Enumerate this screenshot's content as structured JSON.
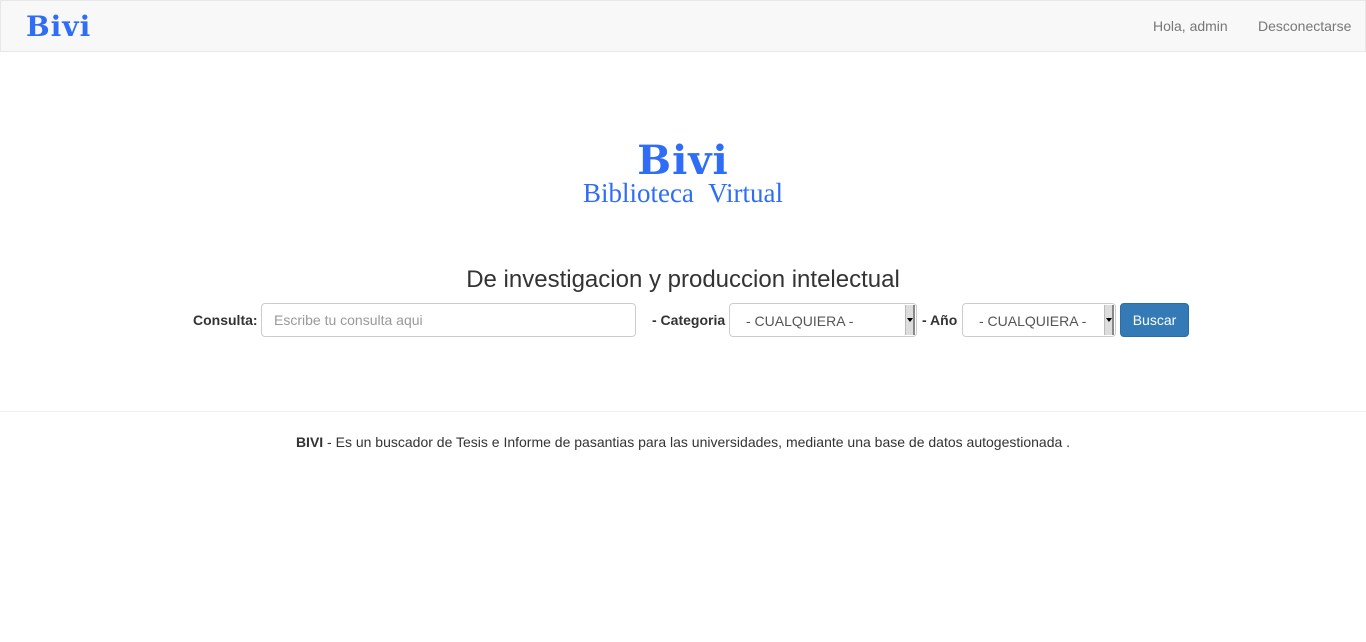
{
  "navbar": {
    "brand": "Bivi",
    "greeting": "Hola, admin",
    "logout": "Desconectarse"
  },
  "hero": {
    "title": "Bivi",
    "subtitle": "Biblioteca  Virtual"
  },
  "tagline": "De investigacion y produccion intelectual",
  "search": {
    "query_label": "Consulta:",
    "query_placeholder": "Escribe tu consulta aqui",
    "query_value": "",
    "category_label": "- Categoria",
    "category_selected": "- CUALQUIERA -",
    "year_label": "- Año",
    "year_selected": "- CUALQUIERA -",
    "submit_label": "Buscar"
  },
  "footer": {
    "brand": "BIVI",
    "description": " - Es un buscador de Tesis e Informe de pasantias para las universidades, mediante una base de datos autogestionada ."
  },
  "colors": {
    "brand": "#2f6df7",
    "button": "#337ab7",
    "navbar_bg": "#f8f8f8"
  }
}
